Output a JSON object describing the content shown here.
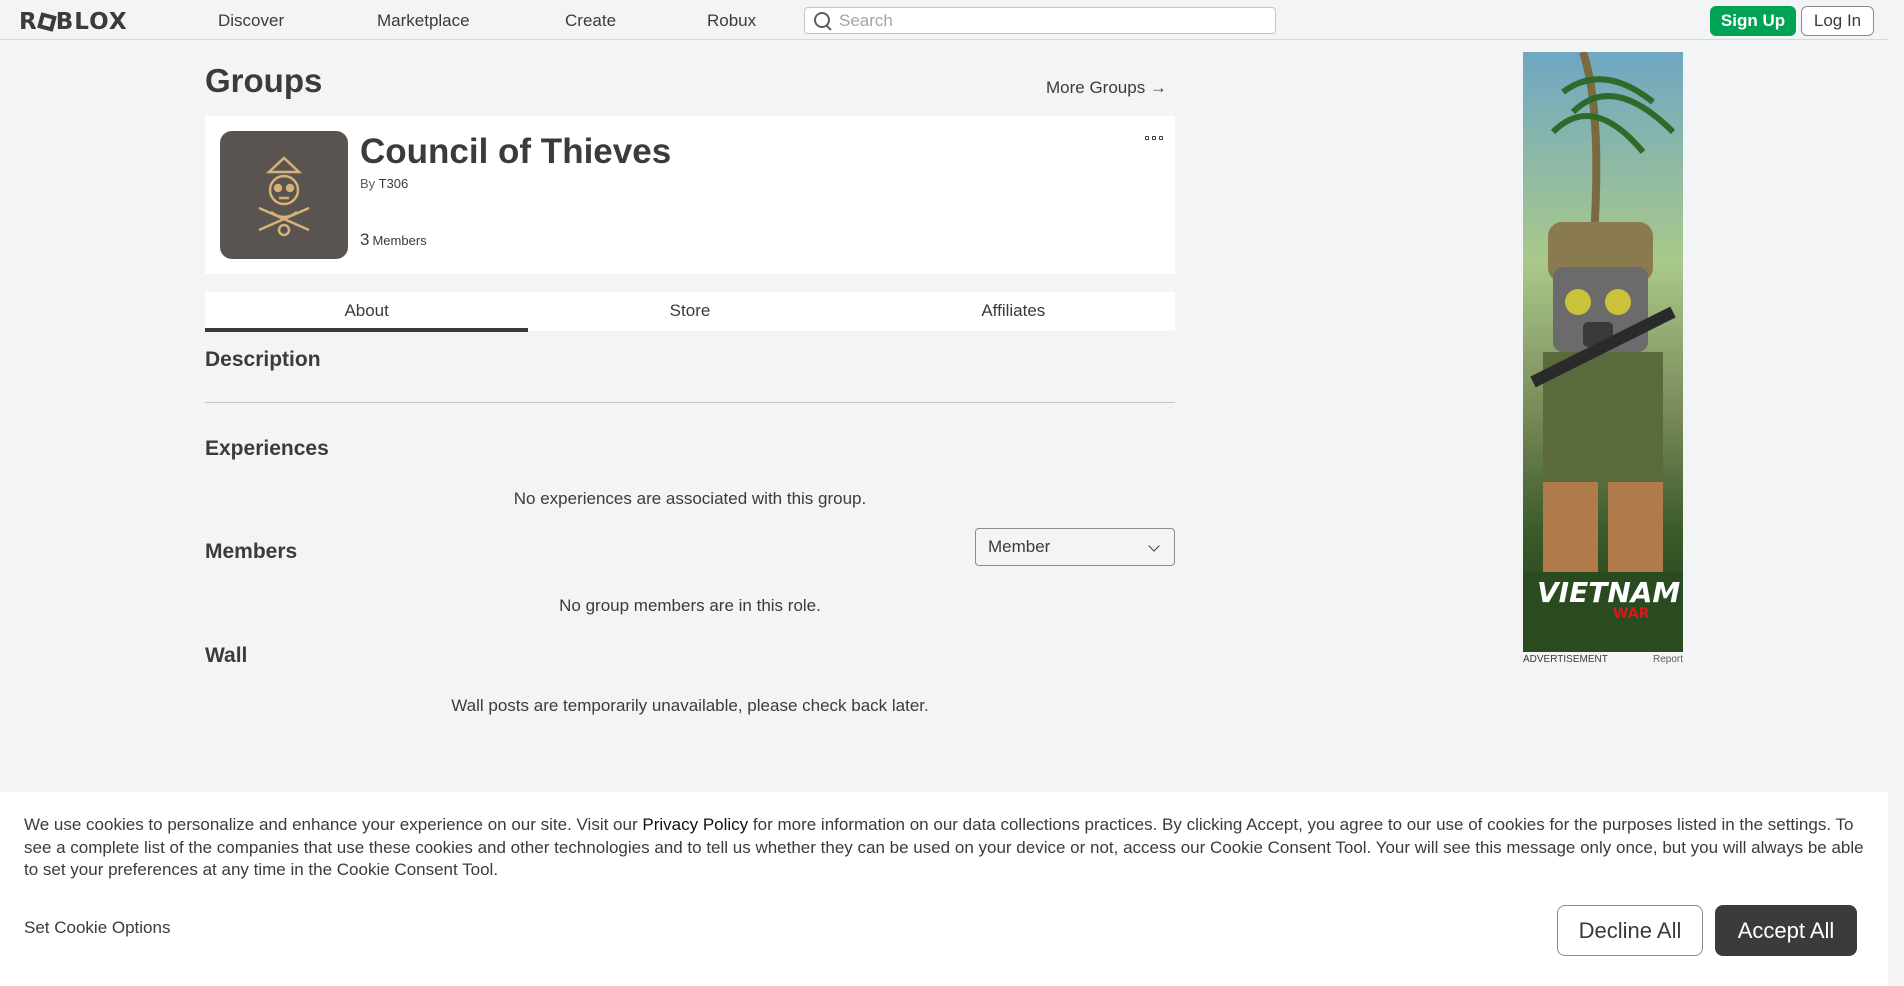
{
  "nav": {
    "logo": "ROBLOX",
    "links": [
      "Discover",
      "Marketplace",
      "Create",
      "Robux"
    ],
    "search_placeholder": "Search",
    "signup_label": "Sign Up",
    "login_label": "Log In"
  },
  "page": {
    "title": "Groups",
    "more_groups": "More Groups →"
  },
  "group": {
    "name": "Council of Thieves",
    "by_prefix": "By",
    "owner": "T306",
    "member_count": "3",
    "member_label": "Members"
  },
  "tabs": [
    "About",
    "Store",
    "Affiliates"
  ],
  "sections": {
    "description": "Description",
    "experiences": "Experiences",
    "experiences_empty": "No experiences are associated with this group.",
    "members": "Members",
    "members_role": "Member",
    "members_empty": "No group members are in this role.",
    "wall": "Wall",
    "wall_empty": "Wall posts are temporarily unavailable, please check back later."
  },
  "ad": {
    "label": "ADVERTISEMENT",
    "report": "Report",
    "art_title": "VIETNAM",
    "art_subtitle": "WAR"
  },
  "cookie": {
    "text_before": "We use cookies to personalize and enhance your experience on our site. Visit our ",
    "privacy_link": "Privacy Policy",
    "text_after": " for more information on our data collections practices. By clicking Accept, you agree to our use of cookies for the purposes listed in the settings. To see a complete list of the companies that use these cookies and other technologies and to tell us whether they can be used on your device or not, access our Cookie Consent Tool. Your will see this message only once, but you will always be able to set your preferences at any time in the Cookie Consent Tool.",
    "set_options": "Set Cookie Options",
    "decline": "Decline All",
    "accept": "Accept All"
  }
}
